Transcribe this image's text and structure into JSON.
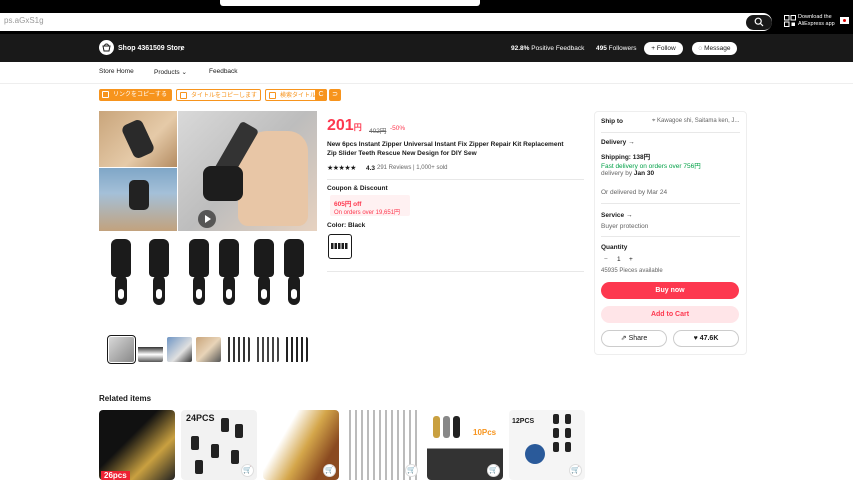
{
  "search": {
    "value": "ps.aGxS1g"
  },
  "app_download": {
    "line1": "Download the",
    "line2": "AliExpress app"
  },
  "store": {
    "name": "Shop 4361509 Store",
    "feedback_value": "92.8%",
    "feedback_label": "Positive Feedback",
    "followers_value": "495",
    "followers_label": "Followers",
    "follow_label": "Follow",
    "message_label": "Message"
  },
  "nav": {
    "items": [
      "Store Home",
      "Products",
      "Feedback"
    ]
  },
  "extension": {
    "copy_link": "リンクをコピーする",
    "copy_title": "タイトルをコピーします",
    "search_title": "検索タイトル"
  },
  "product": {
    "price": "201",
    "price_unit": "円",
    "old_price": "402円",
    "discount": "-50%",
    "title": "New 6pcs Instant Zipper Universal Instant Fix Zipper Repair Kit Replacement Zip Slider Teeth Rescue New Design for DIY Sew",
    "stars": "★★★★★",
    "rating": "4.3",
    "reviews": "291 Reviews",
    "sold": "1,000+ sold",
    "coupon_heading": "Coupon & Discount",
    "coupon_amount": "605円 off",
    "coupon_condition": "On orders over 19,651円",
    "color_heading": "Color: Black"
  },
  "shipping": {
    "ship_to_label": "Ship to",
    "ship_to_value": "Kawagoe shi, Saitama ken, J...",
    "delivery_heading": "Delivery",
    "shipping_cost": "Shipping: 138円",
    "fast_delivery": "Fast delivery on orders over 756円",
    "delivery_by_label": "delivery by",
    "delivery_by_date": "Jan 30",
    "alt_delivery": "Or delivered by Mar 24",
    "service_heading": "Service",
    "service_value": "Buyer protection",
    "quantity_heading": "Quantity",
    "quantity_value": "1",
    "available": "45935 Pieces available",
    "buy_now": "Buy now",
    "add_to_cart": "Add to Cart",
    "share": "Share",
    "wishlist_count": "47.6K"
  },
  "related": {
    "heading": "Related items",
    "badges": [
      "24PCS",
      "10Pcs",
      "12PCS",
      "26pcs"
    ]
  },
  "colors": {
    "accent": "#fd384f",
    "ext_orange": "#f7941d",
    "green": "#00a046",
    "dark": "#191919"
  }
}
